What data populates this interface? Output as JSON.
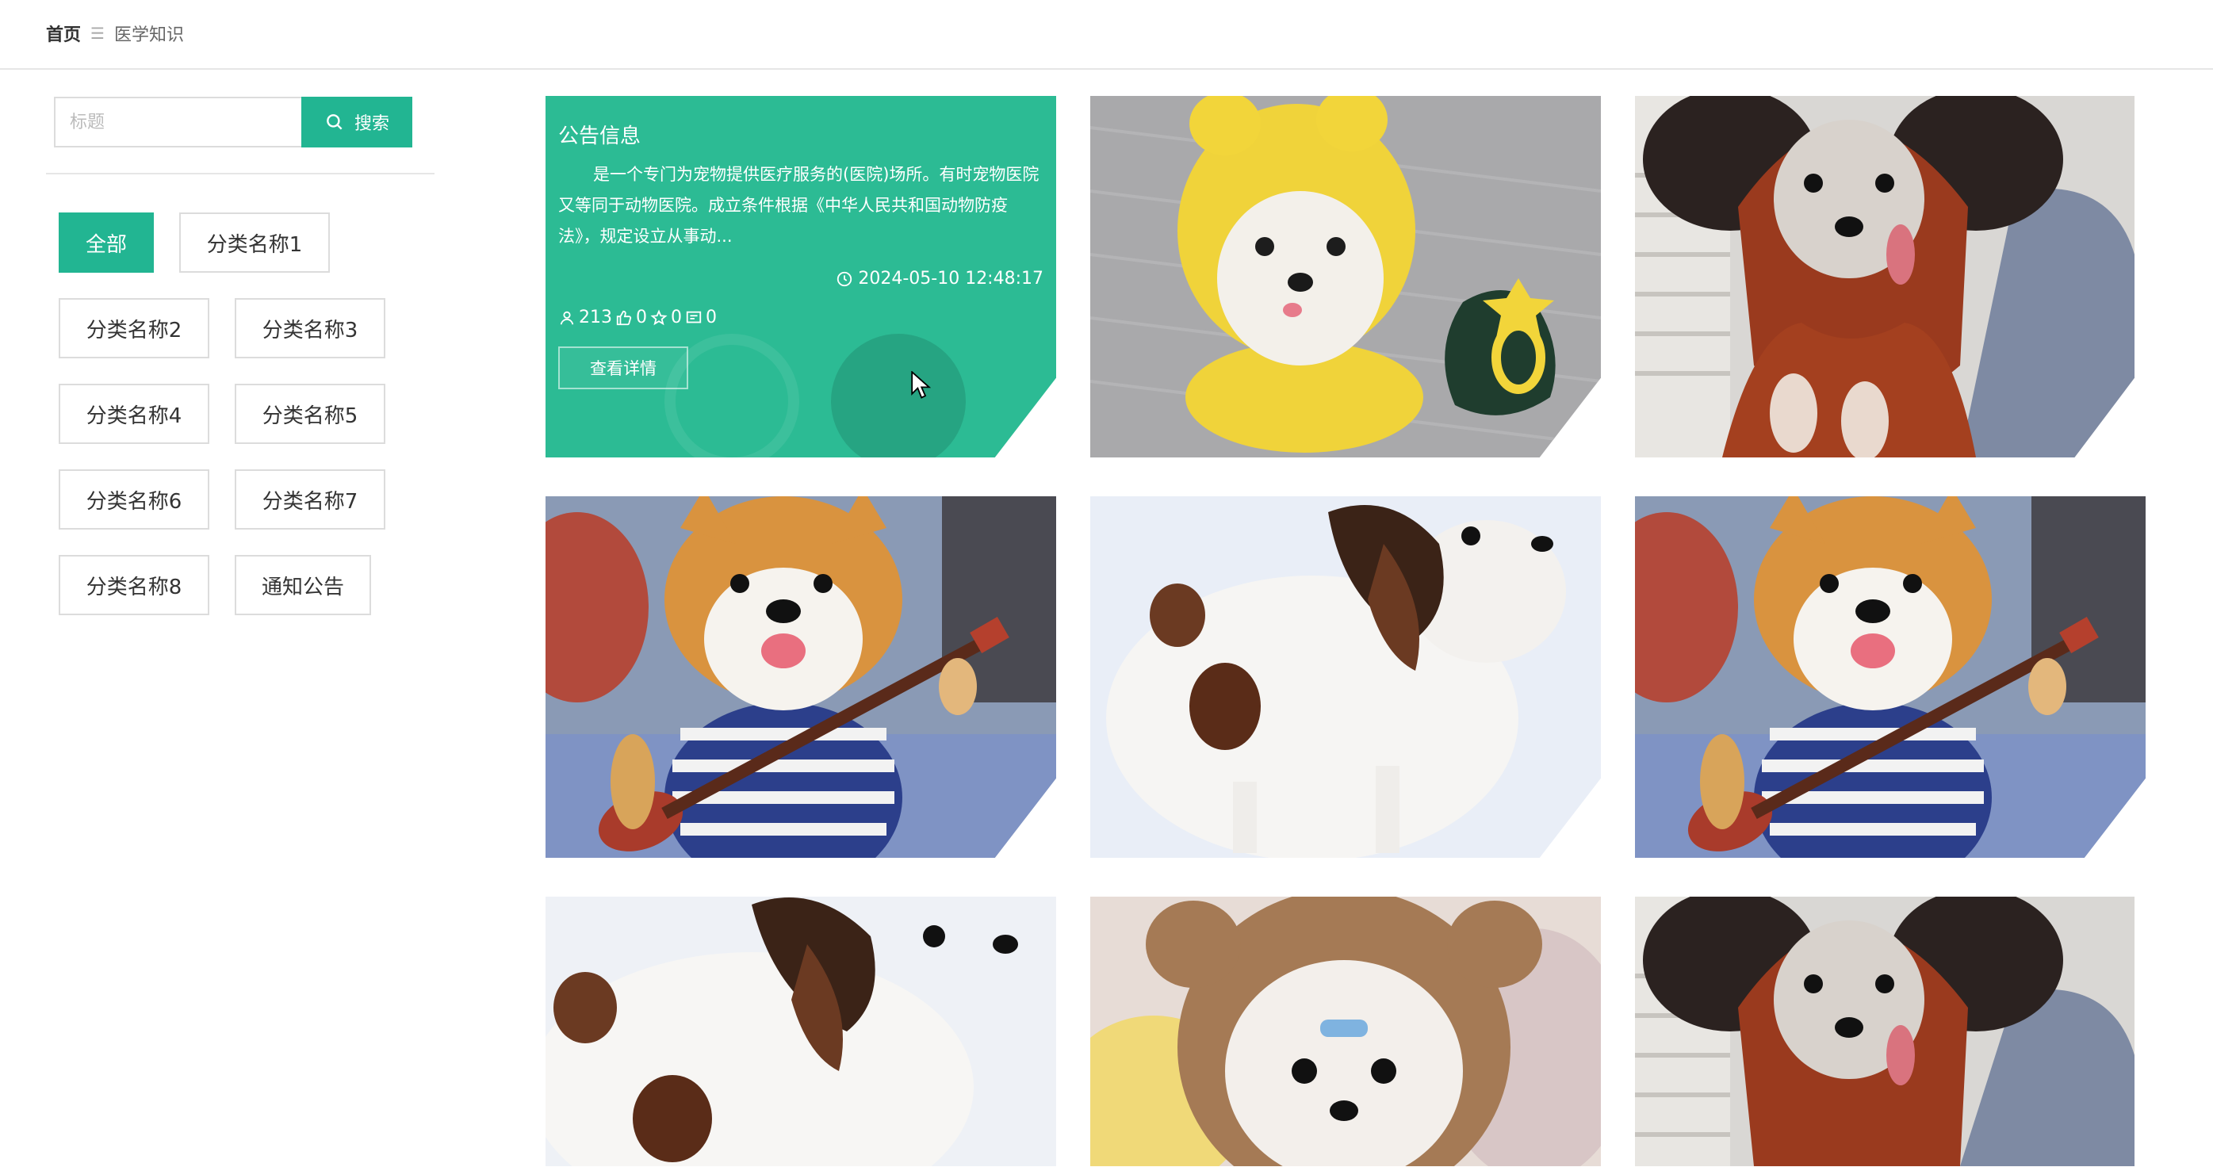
{
  "breadcrumb": {
    "home": "首页",
    "separator": "☰",
    "current": "医学知识"
  },
  "search": {
    "placeholder": "标题",
    "button_label": "搜索"
  },
  "categories": [
    {
      "label": "全部",
      "active": true
    },
    {
      "label": "分类名称1"
    },
    {
      "label": "分类名称2"
    },
    {
      "label": "分类名称3"
    },
    {
      "label": "分类名称4"
    },
    {
      "label": "分类名称5"
    },
    {
      "label": "分类名称6"
    },
    {
      "label": "分类名称7"
    },
    {
      "label": "分类名称8"
    },
    {
      "label": "通知公告"
    }
  ],
  "notice": {
    "title": "公告信息",
    "description": "是一个专门为宠物提供医疗服务的(医院)场所。有时宠物医院又等同于动物医院。成立条件根据《中华人民共和国动物防疫法》，规定设立从事动...",
    "time": "2024-05-10 12:48:17",
    "views": "213",
    "likes": "0",
    "favorites": "0",
    "comments": "0",
    "detail_button": "查看详情"
  },
  "cards": [
    {
      "image": "dog-yellow-hood"
    },
    {
      "image": "dog-red-hoodie"
    },
    {
      "image": "corgi-guitar"
    },
    {
      "image": "papillon"
    },
    {
      "image": "corgi-guitar"
    },
    {
      "image": "papillon"
    },
    {
      "image": "dog-bear-hood"
    },
    {
      "image": "dog-red-hoodie"
    }
  ],
  "colors": {
    "accent": "#22b592",
    "notice_bg": "#2cbb94",
    "divider": "#e6e6e6"
  }
}
